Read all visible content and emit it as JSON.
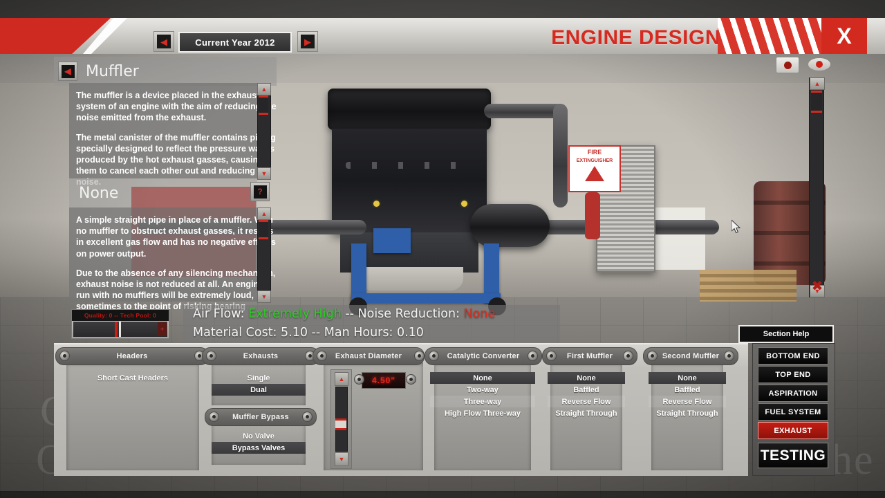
{
  "window": {
    "title": "ENGINE DESIGN",
    "close_label": "X",
    "year_label": "Current Year 2012",
    "prev_year_icon": "left-arrow-icon",
    "next_year_icon": "right-arrow-icon",
    "camera_icon": "camera-icon",
    "eye_icon": "eye-icon"
  },
  "info_panels": [
    {
      "title": "Muffler",
      "back_icon": "left-arrow-icon",
      "paragraphs": [
        "The muffler is a device placed in the exhaust system of an engine with the aim of reducing the noise emitted from the exhaust.",
        "The metal canister of the muffler contains piping specially designed to reflect the pressure waves produced by the hot exhaust gasses, causing them to cancel each other out and reducing noise."
      ]
    },
    {
      "title": "None",
      "help_icon": "question-mark-icon",
      "paragraphs": [
        "A simple straight pipe in place of a muffler. With no muffler to obstruct exhaust gasses, it results in excellent gas flow and has no negative effects on power output.",
        "Due to the absence of any silencing mechanism, exhaust noise is not reduced at all. An engine run with no mufflers will be extremely loud, sometimes to the point of risking hearing injuries to a driver or bystander not wearing"
      ]
    }
  ],
  "stats": {
    "air_flow_label": "Air Flow:",
    "air_flow_value": "Extremely High",
    "sep1": " -- ",
    "noise_label": "Noise Reduction:",
    "noise_value": "None",
    "cost_line": "Material Cost: 5.10 -- Man Hours: 0.10",
    "air_flow_color": "#25d41c",
    "noise_color": "#e02a1c"
  },
  "quality_meter": {
    "label": "Quality: 0 -- Tech Pool: 0",
    "end_marker": "+"
  },
  "columns": [
    {
      "header": "Headers",
      "options": [
        {
          "label": "Short Cast Headers",
          "selected": false
        }
      ]
    },
    {
      "header": "Exhausts",
      "options": [
        {
          "label": "Single",
          "selected": false
        },
        {
          "label": "Dual",
          "selected": true
        }
      ],
      "sub_header": "Muffler Bypass",
      "sub_options": [
        {
          "label": "No Valve",
          "selected": false
        },
        {
          "label": "Bypass Valves",
          "selected": true
        }
      ]
    },
    {
      "header": "Exhaust Diameter",
      "led_value": "4.50\"",
      "slider_up_icon": "up-arrow-icon",
      "slider_down_icon": "down-arrow-icon"
    },
    {
      "header": "Catalytic Converter",
      "options": [
        {
          "label": "None",
          "selected": true
        },
        {
          "label": "Two-way",
          "selected": false
        },
        {
          "label": "Three-way",
          "selected": false
        },
        {
          "label": "High Flow Three-way",
          "selected": false
        }
      ]
    },
    {
      "header": "First Muffler",
      "options": [
        {
          "label": "None",
          "selected": true
        },
        {
          "label": "Baffled",
          "selected": false
        },
        {
          "label": "Reverse Flow",
          "selected": false
        },
        {
          "label": "Straight Through",
          "selected": false
        }
      ]
    },
    {
      "header": "Second Muffler",
      "options": [
        {
          "label": "None",
          "selected": true
        },
        {
          "label": "Baffled",
          "selected": false
        },
        {
          "label": "Reverse Flow",
          "selected": false
        },
        {
          "label": "Straight Through",
          "selected": false
        }
      ]
    }
  ],
  "right_nav": {
    "section_help": "Section Help",
    "items": [
      {
        "label": "BOTTOM END",
        "active": false
      },
      {
        "label": "TOP END",
        "active": false
      },
      {
        "label": "ASPIRATION",
        "active": false
      },
      {
        "label": "FUEL SYSTEM",
        "active": false
      },
      {
        "label": "EXHAUST",
        "active": true
      }
    ],
    "testing_label": "TESTING"
  },
  "scene": {
    "fire_extinguisher_line1": "FIRE",
    "fire_extinguisher_line2": "EXTINGUISHER",
    "watermark_left": "C",
    "watermark_left2": "O",
    "watermark_right": "he"
  }
}
